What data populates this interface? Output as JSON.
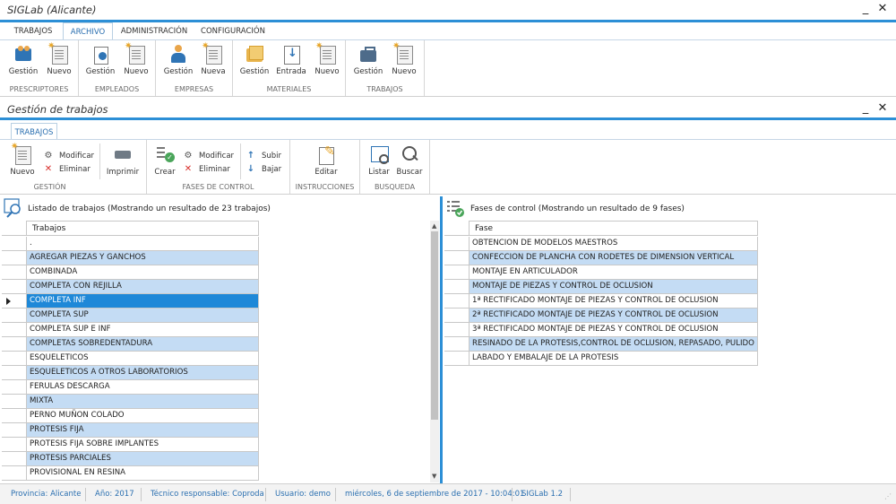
{
  "app": {
    "title": "SIGLab (Alicante)"
  },
  "main_tabs": [
    "TRABAJOS",
    "ARCHIVO",
    "ADMINISTRACIÓN",
    "CONFIGURACIÓN"
  ],
  "main_ribbon": {
    "groups": {
      "prescriptores": {
        "label": "PRESCRIPTORES",
        "buttons": [
          "Gestión",
          "Nuevo"
        ]
      },
      "empleados": {
        "label": "EMPLEADOS",
        "buttons": [
          "Gestión",
          "Nuevo"
        ]
      },
      "empresas": {
        "label": "EMPRESAS",
        "buttons": [
          "Gestión",
          "Nueva"
        ]
      },
      "materiales": {
        "label": "MATERIALES",
        "buttons": [
          "Gestión",
          "Entrada",
          "Nuevo"
        ]
      },
      "trabajos": {
        "label": "TRABAJOS",
        "buttons": [
          "Gestión",
          "Nuevo"
        ]
      }
    }
  },
  "subwindow": {
    "title": "Gestión de trabajos",
    "tab": "TRABAJOS",
    "groups": {
      "gestion": {
        "label": "GESTIÓN",
        "nuevo": "Nuevo",
        "modificar": "Modificar",
        "eliminar": "Eliminar",
        "imprimir": "Imprimir"
      },
      "fases": {
        "label": "FASES DE CONTROL",
        "crear": "Crear",
        "modificar": "Modificar",
        "eliminar": "Eliminar",
        "subir": "Subir",
        "bajar": "Bajar"
      },
      "instrucciones": {
        "label": "INSTRUCCIONES",
        "editar": "Editar"
      },
      "busqueda": {
        "label": "BUSQUEDA",
        "listar": "Listar",
        "buscar": "Buscar"
      }
    }
  },
  "trabajos_panel": {
    "title": "Listado de trabajos (Mostrando un resultado de 23 trabajos)",
    "column": "Trabajos",
    "rows": [
      ".",
      "AGREGAR PIEZAS Y GANCHOS",
      "COMBINADA",
      "COMPLETA CON REJILLA",
      "COMPLETA INF",
      "COMPLETA SUP",
      "COMPLETA SUP E INF",
      "COMPLETAS SOBREDENTADURA",
      "ESQUELETICOS",
      "ESQUELETICOS A OTROS LABORATORIOS",
      "FERULAS DESCARGA",
      "MIXTA",
      "PERNO MUÑON COLADO",
      "PROTESIS FIJA",
      "PROTESIS FIJA SOBRE IMPLANTES",
      "PROTESIS PARCIALES",
      "PROVISIONAL EN RESINA"
    ],
    "selected_index": 4
  },
  "fases_panel": {
    "title": "Fases de control (Mostrando un resultado de 9 fases)",
    "column": "Fase",
    "rows": [
      "OBTENCION DE MODELOS MAESTROS",
      "CONFECCION DE PLANCHA CON RODETES DE DIMENSION VERTICAL",
      "MONTAJE EN ARTICULADOR",
      "MONTAJE DE PIEZAS Y CONTROL DE OCLUSION",
      "1ª RECTIFICADO MONTAJE DE PIEZAS Y CONTROL DE OCLUSION",
      "2ª RECTIFICADO MONTAJE DE PIEZAS Y CONTROL DE OCLUSION",
      "3ª RECTIFICADO MONTAJE DE PIEZAS Y CONTROL DE OCLUSION",
      "RESINADO DE LA PROTESIS,CONTROL DE OCLUSION, REPASADO, PULIDO",
      "LABADO Y EMBALAJE DE LA PROTESIS"
    ]
  },
  "status_bar": {
    "provincia": "Provincia: Alicante",
    "anio": "Año: 2017",
    "tecnico": "Técnico responsable: Coproda",
    "usuario": "Usuario: demo",
    "fecha": "miércoles, 6 de septiembre de 2017 - 10:04:01",
    "version": "SIGLab 1.2"
  },
  "colors": {
    "accent": "#2c8fd6",
    "row_alt": "#c4dcf4",
    "row_selected": "#1e88d8"
  }
}
